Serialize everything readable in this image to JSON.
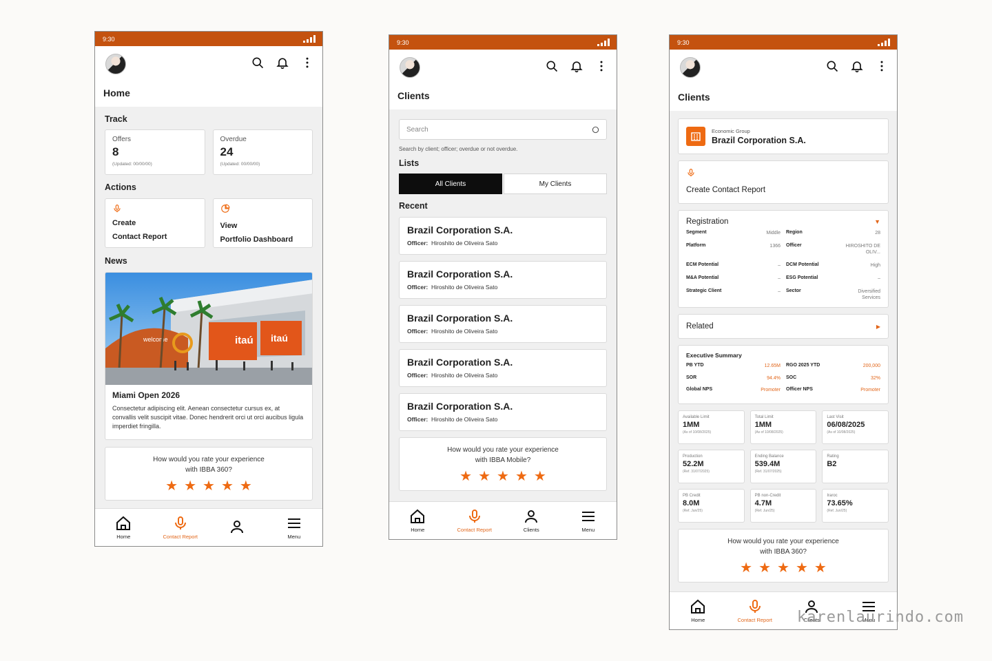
{
  "status_time": "9:30",
  "colors": {
    "brand": "#c4520f",
    "accent": "#ee6a12",
    "dark_tab": "#0d0d0d"
  },
  "home": {
    "title": "Home",
    "track_heading": "Track",
    "track": [
      {
        "label": "Offers",
        "value": "8",
        "updated": "(Updated: 00/00/00)"
      },
      {
        "label": "Overdue",
        "value": "24",
        "updated": "(Updated: 00/00/00)"
      }
    ],
    "actions_heading": "Actions",
    "actions": [
      {
        "line1": "Create",
        "line2": "Contact Report",
        "icon": "microphone-icon"
      },
      {
        "line1": "View",
        "line2": "Portfolio Dashboard",
        "icon": "pie-chart-icon"
      }
    ],
    "news_heading": "News",
    "news": {
      "title": "Miami Open 2026",
      "body": "Consectetur adipiscing elit. Aenean consectetur cursus ex, at convallis velit suscipit vitae. Donec hendrerit orci ut orci aucibus ligula imperdiet fringilla.",
      "banner_text": "welcome",
      "sign_text": "itaú"
    },
    "rating": {
      "line1": "How would you rate your experience",
      "line2": "with IBBA 360?",
      "stars": 5
    },
    "nav": [
      "Home",
      "Contact Report",
      "",
      "Menu"
    ]
  },
  "clients": {
    "title": "Clients",
    "search": {
      "placeholder": "Search",
      "hint": "Search by client; officer; overdue or not overdue."
    },
    "lists_heading": "Lists",
    "tabs": [
      "All Clients",
      "My Clients"
    ],
    "recent_heading": "Recent",
    "officer_label": "Officer:",
    "items": [
      {
        "name": "Brazil Corporation S.A.",
        "officer": "Hiroshito de Oliveira Sato"
      },
      {
        "name": "Brazil Corporation S.A.",
        "officer": "Hiroshito de Oliveira Sato"
      },
      {
        "name": "Brazil Corporation S.A.",
        "officer": "Hiroshito de Oliveira Sato"
      },
      {
        "name": "Brazil Corporation S.A.",
        "officer": "Hiroshito de Oliveira Sato"
      },
      {
        "name": "Brazil Corporation S.A.",
        "officer": "Hiroshito de Oliveira Sato"
      }
    ],
    "rating": {
      "line1": "How would you rate your experience",
      "line2": "with IBBA Mobile?",
      "stars": 5
    },
    "nav": [
      "Home",
      "Contact Report",
      "Clients",
      "Menu"
    ]
  },
  "detail": {
    "title": "Clients",
    "group_label": "Economic Group",
    "group_name": "Brazil Corporation S.A.",
    "create_contact": "Create Contact Report",
    "registration": {
      "title": "Registration",
      "rows": [
        {
          "k1": "Segment",
          "v1": "Middle",
          "k2": "Region",
          "v2": "28"
        },
        {
          "k1": "Platform",
          "v1": "1366",
          "k2": "Officer",
          "v2": "HIROSHITO DE OLIV..."
        },
        {
          "k1": "ECM Potential",
          "v1": "–",
          "k2": "DCM Potential",
          "v2": "High"
        },
        {
          "k1": "M&A Potential",
          "v1": "–",
          "k2": "ESG Potential",
          "v2": "–"
        },
        {
          "k1": "Strategic Client",
          "v1": "–",
          "k2": "Sector",
          "v2": "Diversified Services"
        }
      ]
    },
    "related": "Related",
    "executive": {
      "title": "Executive Summary",
      "rows": [
        {
          "k1": "PB YTD",
          "v1": "12.65M",
          "k2": "RGO 2025 YTD",
          "v2": "200,000"
        },
        {
          "k1": "SOR",
          "v1": "94.4%",
          "k2": "SOC",
          "v2": "32%"
        },
        {
          "k1": "Global NPS",
          "v1": "Promoter",
          "k2": "Officer NPS",
          "v2": "Promoter"
        }
      ]
    },
    "metrics": [
      {
        "label": "Available Limit",
        "value": "1MM",
        "ref": "(As of 10/08/2025)"
      },
      {
        "label": "Total Limit",
        "value": "1MM",
        "ref": "(As of 10/08/2025)"
      },
      {
        "label": "Last Visit",
        "value": "06/08/2025",
        "ref": "(As of 10/08/2025)"
      },
      {
        "label": "Production",
        "value": "52.2M",
        "ref": "(Ref. 31/07/2025)"
      },
      {
        "label": "Ending Balance",
        "value": "539.4M",
        "ref": "(Ref. 31/07/2025)"
      },
      {
        "label": "Rating",
        "value": "B2",
        "ref": ""
      },
      {
        "label": "PB Credit",
        "value": "8.0M",
        "ref": "(Ref. Jun/25)"
      },
      {
        "label": "PB non-Credit",
        "value": "4.7M",
        "ref": "(Ref. Jun/25)"
      },
      {
        "label": "Iraroc",
        "value": "73.65%",
        "ref": "(Ref. Jun/25)"
      }
    ],
    "rating": {
      "line1": "How would you rate your experience",
      "line2": "with IBBA 360?",
      "stars": 5
    },
    "nav": [
      "Home",
      "Contact Report",
      "Clients",
      "Menu"
    ]
  },
  "watermark": "karenlaurindo.com"
}
